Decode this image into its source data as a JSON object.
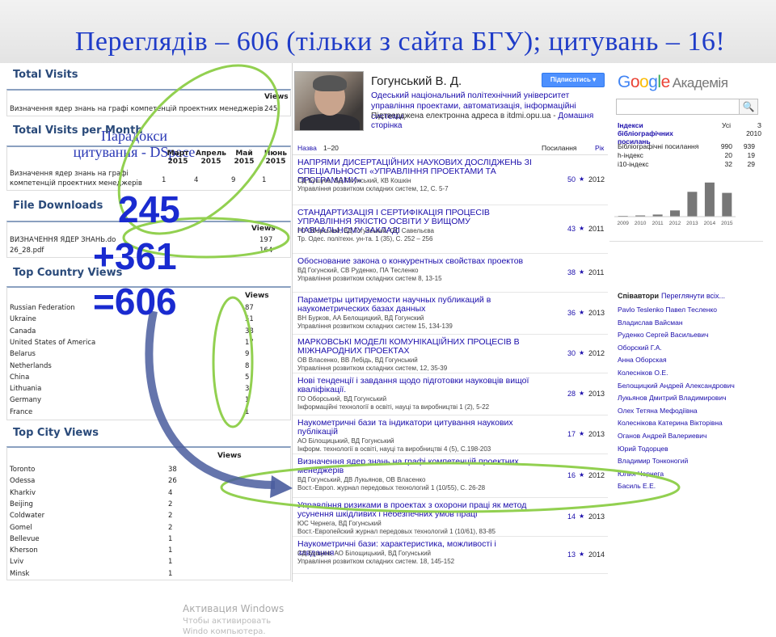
{
  "slide": {
    "title": "Переглядів – 606 (тільки з сайта БГУ);  цитувань – 16!",
    "paradox_line1": "Парадокси",
    "paradox_line2": "цитування - DSpace",
    "num_245": "245",
    "num_361": "+361",
    "num_606": "=606"
  },
  "dspace": {
    "total_visits": {
      "heading": "Total Visits",
      "col": "Views",
      "row_label": "Визначення ядер знань на графі компетенцій проектних менеджерів",
      "row_value": "245"
    },
    "per_month": {
      "heading": "Total Visits per Month",
      "months": [
        "Март 2015",
        "Апрель 2015",
        "Май 2015",
        "Июнь 2015"
      ],
      "row_label_1": "Визначення ядер знань на графі",
      "row_label_2": "компетенцій проектних менеджерів",
      "values": [
        "1",
        "4",
        "9",
        "1"
      ]
    },
    "downloads": {
      "heading": "File Downloads",
      "col": "Views",
      "rows": [
        {
          "label": "ВИЗНАЧЕННЯ ЯДЕР ЗНАНЬ.do",
          "value": "197"
        },
        {
          "label": "26_28.pdf",
          "value": "164"
        }
      ]
    },
    "countries": {
      "heading": "Top Country Views",
      "col": "Views",
      "rows": [
        {
          "label": "Russian Federation",
          "value": "87"
        },
        {
          "label": "Ukraine",
          "value": "51"
        },
        {
          "label": "Canada",
          "value": "38"
        },
        {
          "label": "United States of America",
          "value": "17"
        },
        {
          "label": "Belarus",
          "value": "9"
        },
        {
          "label": "Netherlands",
          "value": "8"
        },
        {
          "label": "China",
          "value": "5"
        },
        {
          "label": "Lithuania",
          "value": "3"
        },
        {
          "label": "Germany",
          "value": "1"
        },
        {
          "label": "France",
          "value": "1"
        }
      ]
    },
    "cities": {
      "heading": "Top City Views",
      "col": "Views",
      "rows": [
        {
          "label": "Toronto",
          "value": "38"
        },
        {
          "label": "Odessa",
          "value": "26"
        },
        {
          "label": "Kharkiv",
          "value": "4"
        },
        {
          "label": "Beijing",
          "value": "2"
        },
        {
          "label": "Coldwater",
          "value": "2"
        },
        {
          "label": "Gomel",
          "value": "2"
        },
        {
          "label": "Bellevue",
          "value": "1"
        },
        {
          "label": "Kherson",
          "value": "1"
        },
        {
          "label": "Lviv",
          "value": "1"
        },
        {
          "label": "Minsk",
          "value": "1"
        }
      ]
    },
    "watermark_line1": "Активация Windows",
    "watermark_line2": "Чтобы активировать Windo компьютера."
  },
  "scholar": {
    "author": "Гогунський В. Д.",
    "affiliation": "Одеський національний політехнічний університет управління проектами, автоматизація, інформаційні системи",
    "verified": "Підтверджена електронна адреса в itdmi.opu.ua -",
    "homepage": "Домашня сторінка",
    "follow": "Підписатись ▾",
    "logo_g": [
      "G",
      "o",
      "o",
      "g",
      "l",
      "e"
    ],
    "logo_colors": [
      "#4285f4",
      "#ea4335",
      "#fbbc05",
      "#4285f4",
      "#34a853",
      "#ea4335"
    ],
    "logo_akad": "Академія",
    "list_head": {
      "name": "Назва",
      "range": "1–20",
      "cites": "Посилання",
      "year": "Рік"
    },
    "pubs": [
      {
        "title": "НАПРЯМИ ДИСЕРТАЦІЙНИХ НАУКОВИХ ДОСЛІДЖЕНЬ ЗІ СПЕЦІАЛЬНОСТІ «УПРАВЛІННЯ ПРОЕКТАМИ ТА ПРОГРАМАМИ»",
        "authors": "СД Бушуєв, ВД Гогунський, КВ Кошкін",
        "venue": "Управління розвитком складних систем, 12, С. 5-7",
        "cites": "50",
        "year": "2012"
      },
      {
        "title": "СТАНДАРТИЗАЦІЯ І СЕРТИФІКАЦІЯ ПРОЦЕСІВ УПРАВЛІННЯ ЯКІСТЮ ОСВІТИ У ВИЩОМУ НАВЧАЛЬНОМУ ЗАКЛАДІ",
        "authors": "ГО Оборський, ВД Гогунський, ОС Савельєва",
        "venue": "Тр. Одес. політехн. ун-та. 1 (35), С. 252 – 256",
        "cites": "43",
        "year": "2011"
      },
      {
        "title": "Обоснование закона о конкурентных свойствах проектов",
        "authors": "ВД Гогунский, СВ Руденко, ПА Тесленко",
        "venue": "Управління розвитком складних систем 8, 13-15",
        "cites": "38",
        "year": "2011"
      },
      {
        "title": "Параметры цитируемости научных публикаций в наукометрических базах данных",
        "authors": "ВН Бурков, АА Белощицкий, ВД Гогунский",
        "venue": "Управління розвитком складних систем 15, 134-139",
        "cites": "36",
        "year": "2013"
      },
      {
        "title": "МАРКОВСЬКІ МОДЕЛІ КОМУНІКАЦІЙНИХ ПРОЦЕСІВ В МІЖНАРОДНИХ ПРОЕКТАХ",
        "authors": "ОВ Власенко, ВВ Лебідь, ВД Гогунський",
        "venue": "Управління розвитком складних систем, 12, 35-39",
        "cites": "30",
        "year": "2012"
      },
      {
        "title": "Нові тенденції і завдання щодо підготовки науковців вищої кваліфікації.",
        "authors": "ГО Оборський, ВД Гогунський",
        "venue": "Інформаційні технології в освіті, науці та виробництві 1 (2), 5-22",
        "cites": "28",
        "year": "2013"
      },
      {
        "title": "Наукометричні бази та індикатори цитування наукових публікацій",
        "authors": "АО Білощицький, ВД Гогунський",
        "venue": "Інформ. технології в освіті, науці та виробництві 4 (5), С.198-203",
        "cites": "17",
        "year": "2013"
      },
      {
        "title": "Визначення ядер знань на графі компетенцій проектних менеджерів",
        "authors": "ВД Гогунський, ДВ Лукьянов, ОВ Власенко",
        "venue": "Вост.-Европ. журнал передовых технологий 1 (10/55), С. 26-28",
        "cites": "16",
        "year": "2012"
      },
      {
        "title": "Управління ризиками в проектах з охорони праці як метод усунення шкідливих і небезпечних умов праці",
        "authors": "ЮС Чернега, ВД Гогунський",
        "venue": "Вост.-Европейский журнал передовых технологий 1 (10/61), 83-85",
        "cites": "14",
        "year": "2013"
      },
      {
        "title": "Наукометричні бази: характеристика, можливості і завдання",
        "authors": "СД Бушуєв, АО Білощицький, ВД Гогунський",
        "venue": "Управління розвитком складних систем. 18, 145-152",
        "cites": "13",
        "year": "2014"
      }
    ],
    "indices": {
      "heading": "Індекси бібліографічних посилань",
      "col_all": "Усі",
      "col_since_1": "З",
      "col_since_2": "2010",
      "rows": [
        {
          "label": "Бібліографічні посилання",
          "all": "990",
          "since": "939"
        },
        {
          "label": "h-індекс",
          "all": "20",
          "since": "19"
        },
        {
          "label": "i10-індекс",
          "all": "32",
          "since": "29"
        }
      ]
    },
    "chart_data": {
      "type": "bar",
      "categories": [
        "2009",
        "2010",
        "2011",
        "2012",
        "2013",
        "2014",
        "2015"
      ],
      "values": [
        8,
        12,
        20,
        60,
        240,
        330,
        230
      ],
      "ylim": [
        0,
        360
      ]
    },
    "coauthors_heading": "Співавтори",
    "coauthors_all": "Переглянути всіх...",
    "coauthors": [
      "Pavlo Teslenko Павел Тесленко",
      "Владислав Вайсман",
      "Руденко Сергей Васильевич",
      "Оборский Г.А.",
      "Анна Оборская",
      "Колесніков О.Е.",
      "Белощицкий Андрей Александрович",
      "Лукьянов Дмитрий Владимирович",
      "Олех Тетяна Мефодіївна",
      "Колеснікова Катерина Вікторівна",
      "Оганов Андрей Валериевич",
      "Юрий Тодорцев",
      "Владимир Тонконогий",
      "Юлия Чернега",
      "Басиль Е.Е."
    ]
  }
}
